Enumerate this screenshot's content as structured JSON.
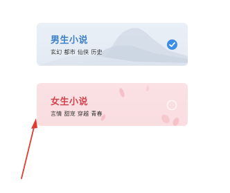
{
  "options": {
    "male": {
      "title": "男生小说",
      "genres": "玄幻 都市 仙侠 历史",
      "selected": true,
      "accent_color": "#3b7fc9",
      "selection_icon": "check-circle-icon"
    },
    "female": {
      "title": "女生小说",
      "genres": "言情 甜宠 穿越 青春",
      "selected": false,
      "accent_color": "#d3434d",
      "selection_icon": "empty-circle-icon"
    }
  },
  "annotation": {
    "icon": "red-arrow",
    "color": "#e03b2f"
  }
}
